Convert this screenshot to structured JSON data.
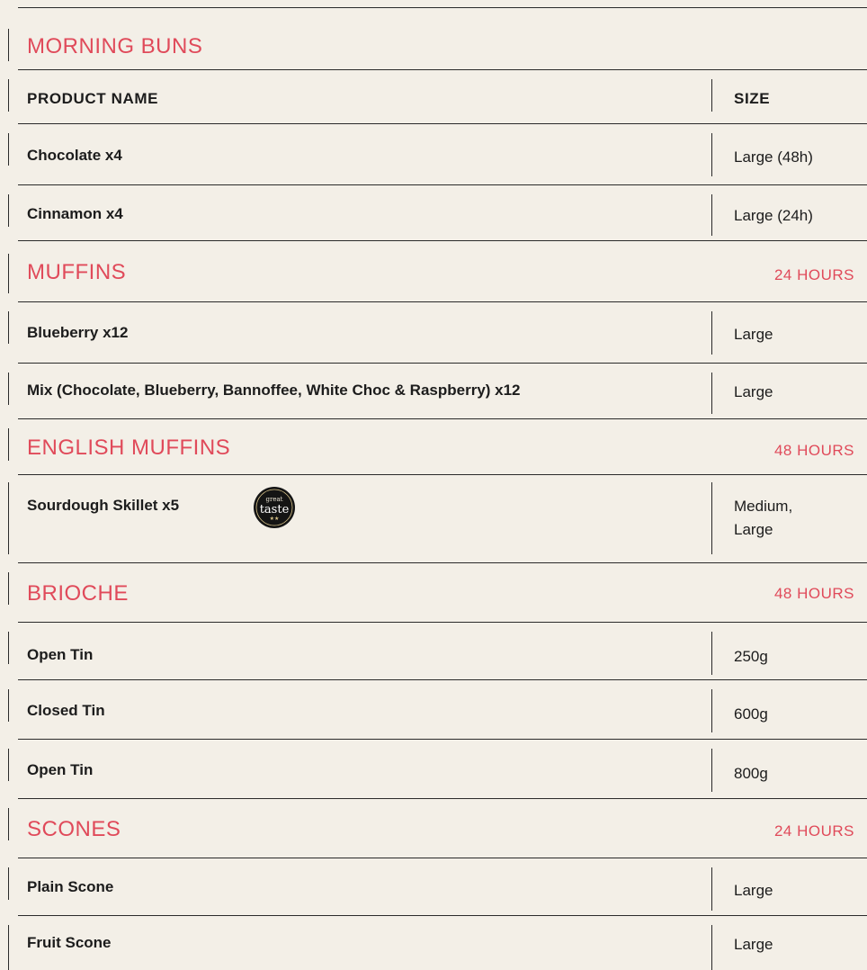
{
  "table": {
    "header": {
      "product_name": "PRODUCT NAME",
      "size": "SIZE"
    },
    "sections": [
      {
        "title": "MORNING BUNS",
        "time": "",
        "items": [
          {
            "name": "Chocolate x4",
            "size": "Large (48h)"
          },
          {
            "name": "Cinnamon x4",
            "size": "Large (24h)"
          }
        ]
      },
      {
        "title": "MUFFINS",
        "time": "24 HOURS",
        "items": [
          {
            "name": "Blueberry  x12",
            "size": "Large"
          },
          {
            "name": "Mix (Chocolate, Blueberry, Bannoffee, White Choc & Raspberry) x12",
            "size": "Large"
          }
        ]
      },
      {
        "title": "ENGLISH MUFFINS",
        "time": "48 HOURS",
        "items": [
          {
            "name": "Sourdough Skillet x5",
            "size": "Medium,\nLarge",
            "badge": {
              "line1": "great",
              "line2": "taste"
            }
          }
        ]
      },
      {
        "title": "BRIOCHE",
        "time": "48 HOURS",
        "items": [
          {
            "name": "Open Tin",
            "size": "250g"
          },
          {
            "name": "Closed Tin",
            "size": "600g"
          },
          {
            "name": "Open Tin",
            "size": "800g"
          }
        ]
      },
      {
        "title": "SCONES",
        "time": "24 HOURS",
        "items": [
          {
            "name": "Plain Scone",
            "size": "Large"
          },
          {
            "name": "Fruit Scone",
            "size": "Large"
          }
        ]
      }
    ]
  },
  "colors": {
    "background": "#f3efe7",
    "accent": "#e04a5a",
    "text": "#1c1c1c",
    "rule": "#2a2a2a"
  }
}
